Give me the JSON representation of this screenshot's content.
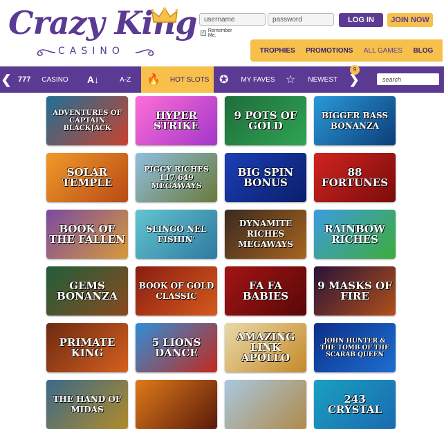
{
  "brand": {
    "title": "Crazy King",
    "subtitle": "CASINO"
  },
  "login": {
    "username_placeholder": "username",
    "password_placeholder": "password",
    "login_label": "LOG IN",
    "join_label": "JOIN NOW",
    "remember_label": "Remember Me."
  },
  "topnav": {
    "items": [
      {
        "label": "TROPHIES"
      },
      {
        "label": "PROMOTIONS"
      },
      {
        "label": "ALL GAMES"
      },
      {
        "label": "BLOG"
      }
    ]
  },
  "categories": {
    "items": [
      {
        "label": "CASINO"
      },
      {
        "label": "A-Z"
      },
      {
        "label": "HOT SLOTS"
      },
      {
        "label": "MY FAVES"
      },
      {
        "label": "NEWEST"
      }
    ],
    "newest_badge": "9",
    "search_placeholder": "search"
  },
  "games": [
    {
      "title": "ADVENTURES OF CAPTAIN BLACKJACK"
    },
    {
      "title": "HYPER STRIKE"
    },
    {
      "title": "9 POTS OF GOLD"
    },
    {
      "title": "BIGGER BASS BONANZA"
    },
    {
      "title": "SOLAR TEMPLE"
    },
    {
      "title": "PIGGY RICHES 117,649 MEGAWAYS"
    },
    {
      "title": "BIG SPIN BONUS"
    },
    {
      "title": "88 FORTUNES"
    },
    {
      "title": "BOOK OF THE FALLEN"
    },
    {
      "title": "SLINGO NEL FISHIN'"
    },
    {
      "title": "DYNAMITE RICHES MEGAWAYS"
    },
    {
      "title": "RAINBOW RICHES"
    },
    {
      "title": "GEMS BONANZA"
    },
    {
      "title": "BOOK OF GOLD CLASSIC"
    },
    {
      "title": "FA FA BABIES"
    },
    {
      "title": "9 MASKS OF FIRE"
    },
    {
      "title": "PRIMATE KING"
    },
    {
      "title": "5 LIONS DANCE"
    },
    {
      "title": "AMAZING LINK APOLLO"
    },
    {
      "title": "JOHN HUNTER & THE TOMB OF THE SCARAB QUEEN"
    },
    {
      "title": "THE HAND OF MIDAS"
    },
    {
      "title": ""
    },
    {
      "title": ""
    },
    {
      "title": "243 CRYSTAL"
    }
  ],
  "colors": {
    "brand_purple": "#5b3a93",
    "accent_gold": "#f7c04a"
  }
}
